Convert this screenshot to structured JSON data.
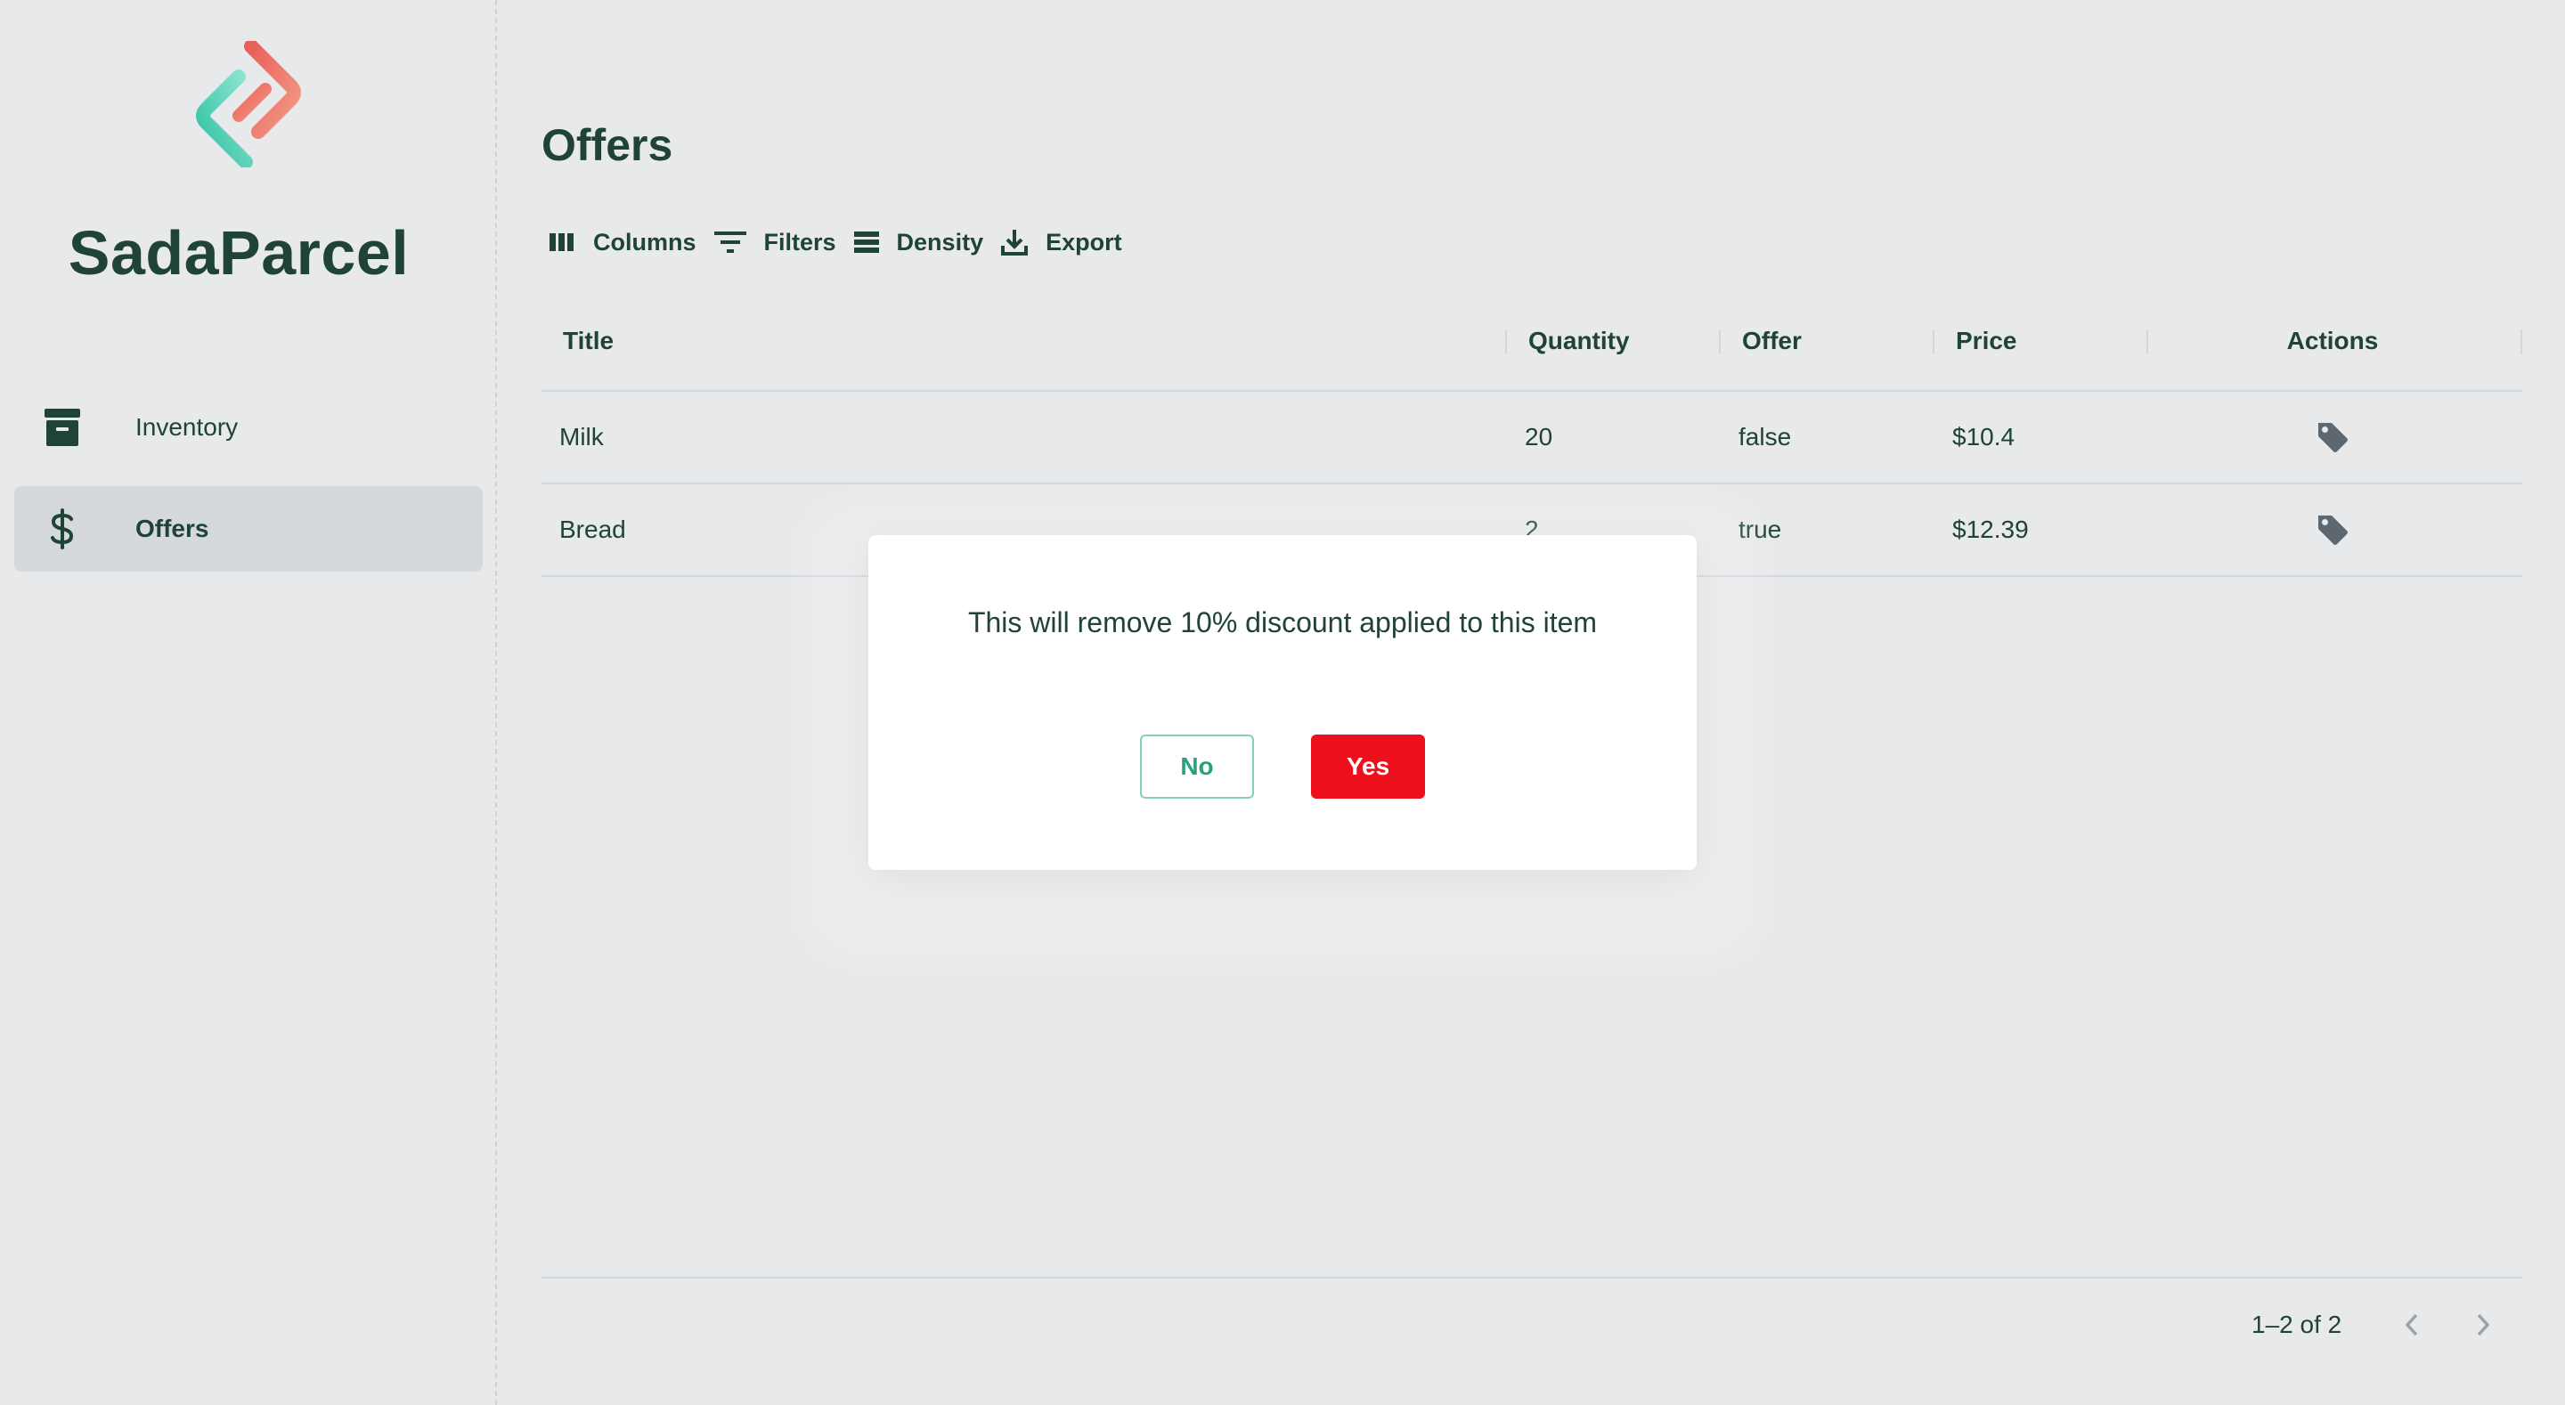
{
  "app": {
    "brand_name": "SadaParcel",
    "logo_icon": "sadaparcel-logo",
    "colors": {
      "text_primary": "#1f4336",
      "background": "#e8e9eb",
      "active_nav": "#d6d9dc",
      "danger": "#ee0f1d",
      "accent_green": "#2aa07e",
      "logo_teal": "#5fd6bf",
      "logo_coral": "#ec6f62"
    }
  },
  "sidebar": {
    "items": [
      {
        "label": "Inventory",
        "icon": "archive-box-icon",
        "active": false
      },
      {
        "label": "Offers",
        "icon": "dollar-icon",
        "active": true
      }
    ]
  },
  "page": {
    "title": "Offers"
  },
  "toolbar": {
    "columns_label": "Columns",
    "filters_label": "Filters",
    "density_label": "Density",
    "export_label": "Export"
  },
  "table": {
    "headers": {
      "title": "Title",
      "quantity": "Quantity",
      "offer": "Offer",
      "price": "Price",
      "actions": "Actions"
    },
    "rows": [
      {
        "title": "Milk",
        "quantity": "20",
        "offer": "false",
        "price": "$10.4",
        "action_icon": "tag-icon"
      },
      {
        "title": "Bread",
        "quantity": "2",
        "offer": "true",
        "price": "$12.39",
        "action_icon": "tag-icon"
      }
    ]
  },
  "pagination": {
    "range_text": "1–2 of 2"
  },
  "dialog": {
    "message": "This will remove 10% discount applied to this item",
    "no_label": "No",
    "yes_label": "Yes"
  }
}
